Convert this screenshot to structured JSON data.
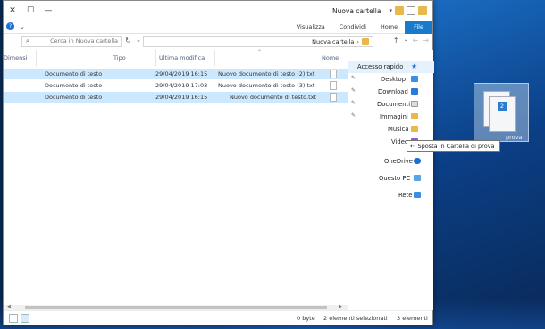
{
  "window": {
    "title": "Nuova cartella"
  },
  "ribbon": {
    "tabs": [
      "File",
      "Home",
      "Condividi",
      "Visualizza"
    ]
  },
  "address": {
    "search_placeholder": "Cerca in Nuova cartella",
    "path": "Nuova cartella"
  },
  "columns": {
    "name": "Nome",
    "modified": "Ultima modifica",
    "type": "Tipo",
    "size": "Dimensi"
  },
  "files": [
    {
      "name": "Nuovo documento di testo (2).txt",
      "modified": "29/04/2019 16:15",
      "type": "Documento di testo",
      "size": "",
      "selected": true
    },
    {
      "name": "Nuovo documento di testo (3).txt",
      "modified": "29/04/2019 17:03",
      "type": "Documento di testo",
      "size": "",
      "selected": false
    },
    {
      "name": "Nuovo documento di testo.txt",
      "modified": "29/04/2019 16:15",
      "type": "Documento di testo",
      "size": "",
      "selected": true
    }
  ],
  "nav": {
    "quick_access": "Accesso rapido",
    "items": [
      {
        "label": "Desktop",
        "pinned": true
      },
      {
        "label": "Download",
        "pinned": true
      },
      {
        "label": "Documenti",
        "pinned": true
      },
      {
        "label": "Immagini",
        "pinned": true
      },
      {
        "label": "Musica",
        "pinned": false
      },
      {
        "label": "Video",
        "pinned": false
      }
    ],
    "onedrive": "OneDrive",
    "this_pc": "Questo PC",
    "network": "Rete"
  },
  "drag": {
    "tooltip": "Sposta in Cartella di prova",
    "badge": "2",
    "ghost_label": "prova"
  },
  "status": {
    "count": "3 elementi",
    "selection": "2 elementi selezionati",
    "size": "0 byte"
  },
  "colors": {
    "accent": "#1979ca",
    "selection": "#cce8ff",
    "folder": "#e8b94a"
  }
}
